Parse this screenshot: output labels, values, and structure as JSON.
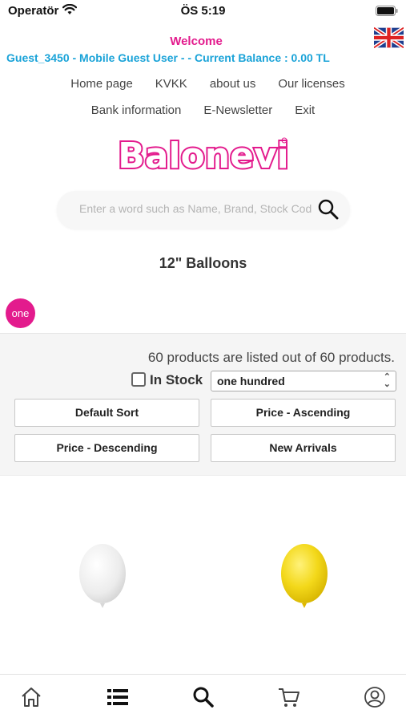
{
  "status_bar": {
    "carrier": "Operatör",
    "time": "ÖS 5:19"
  },
  "header": {
    "welcome": "Welcome",
    "guest_info": "Guest_3450 - Mobile Guest User - - Current Balance : 0.00 TL",
    "language_flag": "uk-flag-icon"
  },
  "nav": {
    "row1": [
      "Home page",
      "KVKK",
      "about us",
      "Our licenses"
    ],
    "row2": [
      "Bank information",
      "E-Newsletter",
      "Exit"
    ]
  },
  "logo": {
    "text": "Balonevi"
  },
  "search": {
    "placeholder": "Enter a word such as Name, Brand, Stock Code"
  },
  "category": {
    "title": "12\" Balloons"
  },
  "pagination": {
    "current_page": "one"
  },
  "filters": {
    "product_count": "60 products are listed out of 60 products.",
    "in_stock_label": "In Stock",
    "in_stock_checked": false,
    "page_size": "one hundred",
    "sort_buttons": [
      "Default Sort",
      "Price - Ascending",
      "Price - Descending",
      "New Arrivals"
    ]
  },
  "products": [
    {
      "color_name": "white",
      "color": "#f1f1f1"
    },
    {
      "color_name": "yellow",
      "color": "#f5dc1e"
    }
  ],
  "tab_bar": [
    "home-icon",
    "list-icon",
    "search-icon",
    "cart-icon",
    "user-icon"
  ],
  "colors": {
    "accent_pink": "#e31b8d",
    "accent_blue": "#1aa3d8"
  }
}
